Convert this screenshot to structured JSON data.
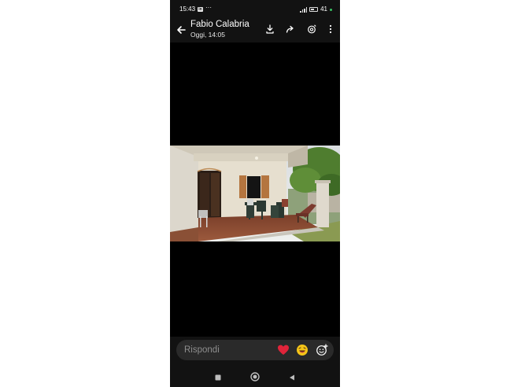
{
  "status": {
    "time": "15:43",
    "linkedin_badge": "in",
    "more_dots": "···",
    "battery_level": "41",
    "colors": {
      "notification_dot": "#39c464"
    }
  },
  "header": {
    "back_icon": "arrow-left-icon",
    "contact_name": "Fabio Calabria",
    "timestamp": "Oggi, 14:05",
    "action_icons": [
      "download-icon",
      "forward-icon",
      "edit-photo-icon",
      "more-vert-icon"
    ]
  },
  "media": {
    "type": "photo",
    "subject": "veranda-with-garden-furniture"
  },
  "reply_bar": {
    "placeholder": "Rispondi",
    "reactions": [
      "heart",
      "laughing-face"
    ],
    "add_reaction_icon": "add-emoji-icon",
    "colors": {
      "heart": "#e0243a",
      "emoji": "#f5c518"
    }
  },
  "navbar": {
    "icons": [
      "recents-square-icon",
      "home-circle-icon",
      "back-triangle-icon"
    ]
  }
}
